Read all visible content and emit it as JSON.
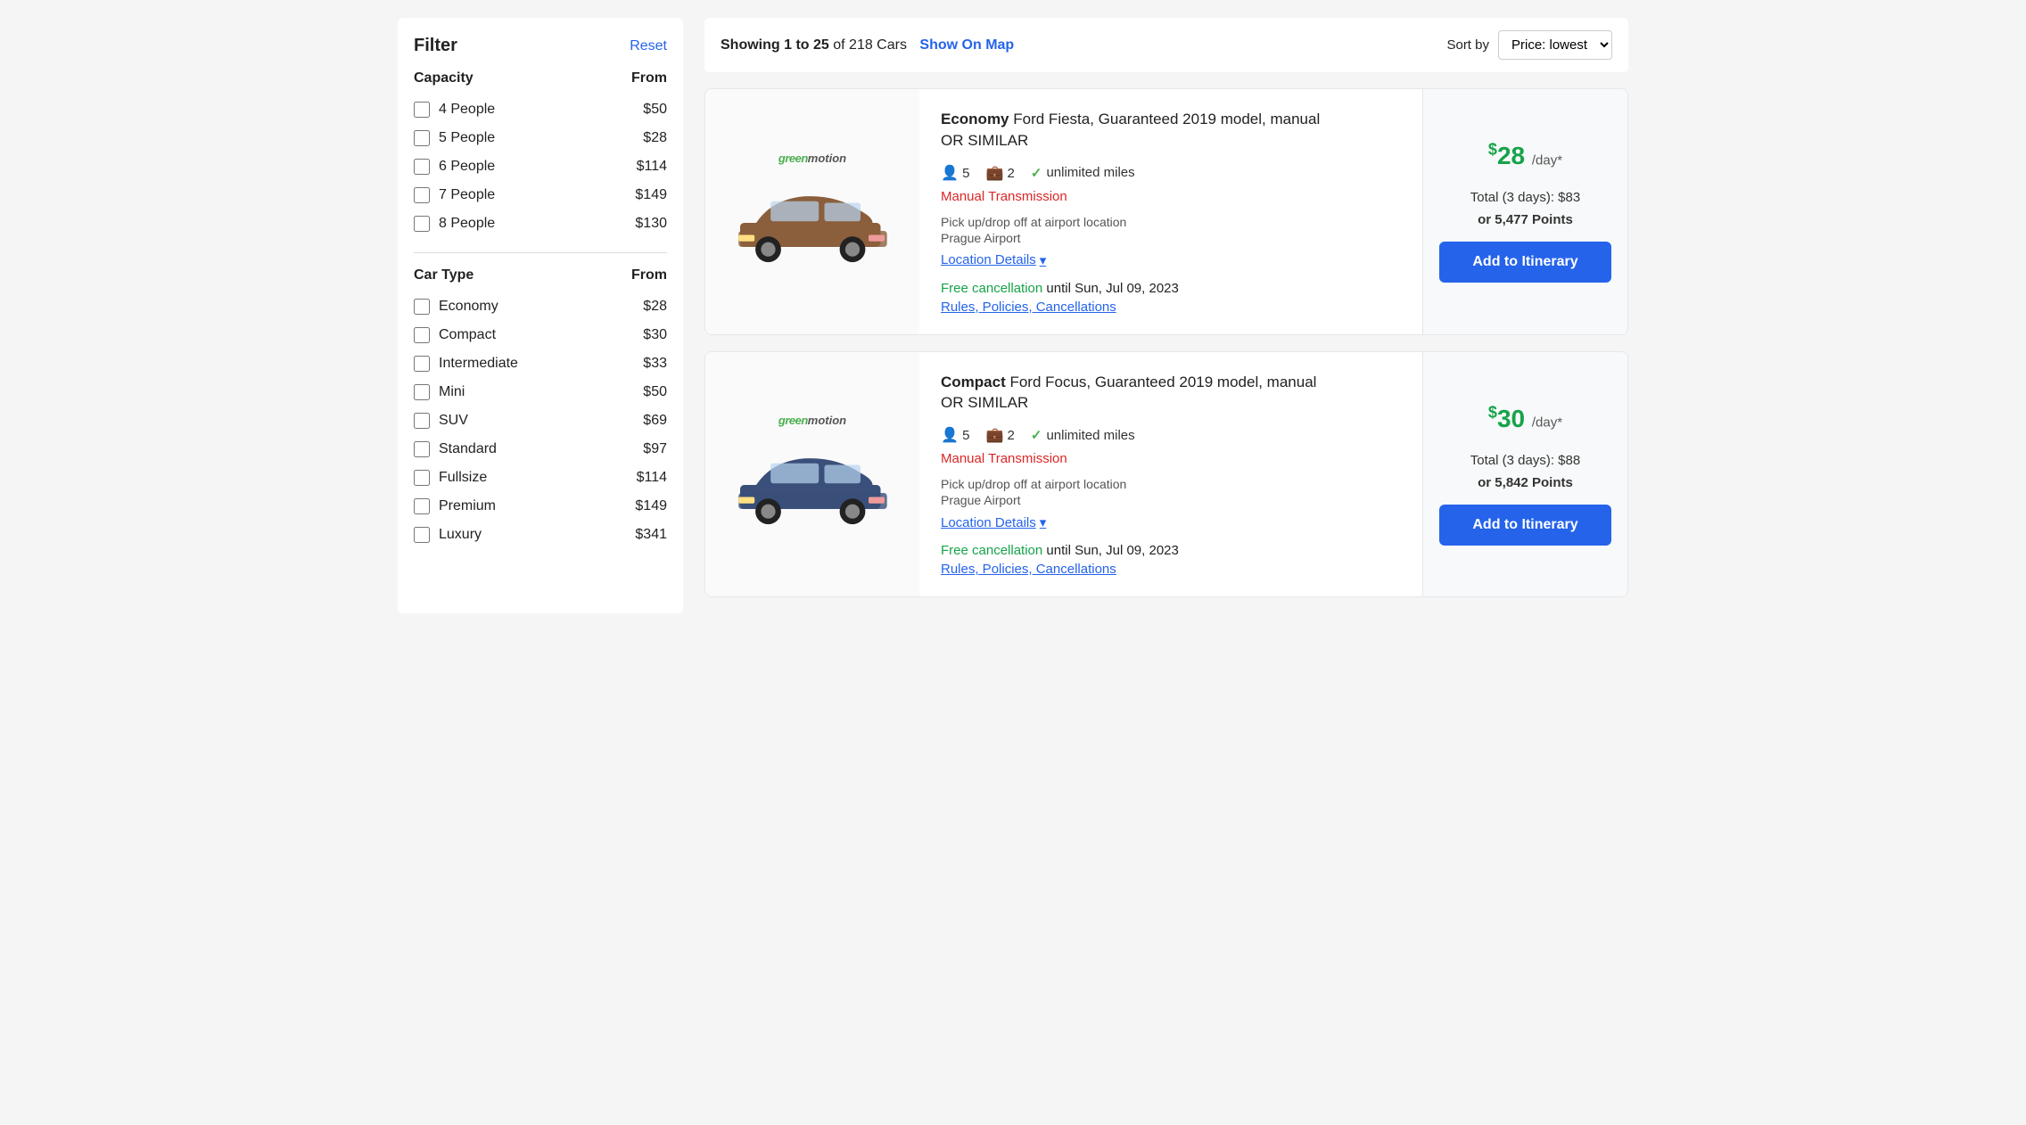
{
  "header": {
    "showing_text": "Showing 1 to 25",
    "of_text": "of 218 Cars",
    "show_on_map": "Show On Map",
    "sort_by_label": "Sort by",
    "sort_option": "Price: lowest"
  },
  "sidebar": {
    "filter_title": "Filter",
    "reset_label": "Reset",
    "capacity_section": {
      "label": "Capacity",
      "from_label": "From",
      "items": [
        {
          "label": "4 People",
          "price": "$50"
        },
        {
          "label": "5 People",
          "price": "$28"
        },
        {
          "label": "6 People",
          "price": "$114"
        },
        {
          "label": "7 People",
          "price": "$149"
        },
        {
          "label": "8 People",
          "price": "$130"
        }
      ]
    },
    "car_type_section": {
      "label": "Car Type",
      "from_label": "From",
      "items": [
        {
          "label": "Economy",
          "price": "$28"
        },
        {
          "label": "Compact",
          "price": "$30"
        },
        {
          "label": "Intermediate",
          "price": "$33"
        },
        {
          "label": "Mini",
          "price": "$50"
        },
        {
          "label": "SUV",
          "price": "$69"
        },
        {
          "label": "Standard",
          "price": "$97"
        },
        {
          "label": "Fullsize",
          "price": "$114"
        },
        {
          "label": "Premium",
          "price": "$149"
        },
        {
          "label": "Luxury",
          "price": "$341"
        }
      ]
    }
  },
  "cars": [
    {
      "id": "car-1",
      "vendor": "greenmotion",
      "car_type": "Economy",
      "car_model": "Ford Fiesta, Guaranteed 2019 model, manual",
      "or_similar": "OR SIMILAR",
      "passengers": "5",
      "bags": "2",
      "miles": "unlimited miles",
      "transmission": "Manual Transmission",
      "pickup_info": "Pick up/drop off at airport location",
      "airport": "Prague Airport",
      "location_details": "Location Details",
      "free_cancellation_prefix": "Free cancellation",
      "free_cancellation_date": "until Sun, Jul 09, 2023",
      "rules_link": "Rules, Policies, Cancellations",
      "price_day": "28",
      "price_suffix": "/day*",
      "total_label": "Total (3 days): $83",
      "or_points": "or 5,477 Points",
      "add_btn": "Add to Itinerary",
      "color": "#8B5E3C"
    },
    {
      "id": "car-2",
      "vendor": "greenmotion",
      "car_type": "Compact",
      "car_model": "Ford Focus, Guaranteed 2019 model, manual",
      "or_similar": "OR SIMILAR",
      "passengers": "5",
      "bags": "2",
      "miles": "unlimited miles",
      "transmission": "Manual Transmission",
      "pickup_info": "Pick up/drop off at airport location",
      "airport": "Prague Airport",
      "location_details": "Location Details",
      "free_cancellation_prefix": "Free cancellation",
      "free_cancellation_date": "until Sun, Jul 09, 2023",
      "rules_link": "Rules, Policies, Cancellations",
      "price_day": "30",
      "price_suffix": "/day*",
      "total_label": "Total (3 days): $88",
      "or_points": "or 5,842 Points",
      "add_btn": "Add to Itinerary",
      "color": "#3a4f7a"
    }
  ]
}
